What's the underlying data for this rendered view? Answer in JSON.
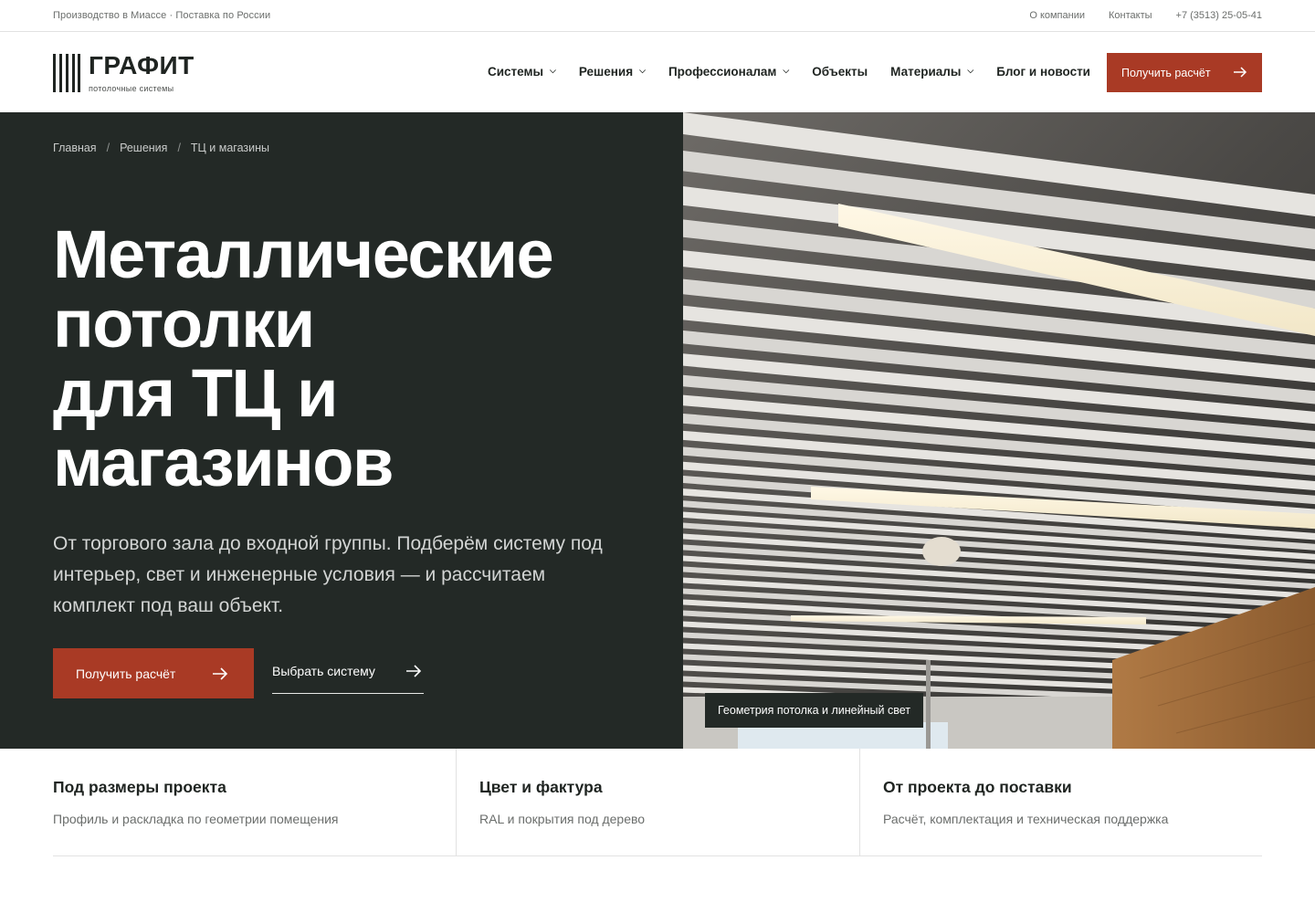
{
  "topbar": {
    "tagline": "Производство в Миассе · Поставка по России",
    "links": [
      "О компании",
      "Контакты",
      "+7 (3513) 25-05-41"
    ]
  },
  "brand": {
    "name": "ГРАФИТ",
    "subtitle": "потолочные системы"
  },
  "nav": {
    "items": [
      {
        "label": "Системы",
        "has_dropdown": true
      },
      {
        "label": "Решения",
        "has_dropdown": true
      },
      {
        "label": "Профессионалам",
        "has_dropdown": true
      },
      {
        "label": "Объекты",
        "has_dropdown": false
      },
      {
        "label": "Материалы",
        "has_dropdown": true
      },
      {
        "label": "Блог и новости",
        "has_dropdown": false
      }
    ],
    "cta_label": "Получить расчёт"
  },
  "breadcrumb": {
    "items": [
      "Главная",
      "Решения",
      "ТЦ и магазины"
    ],
    "separator": "/"
  },
  "hero": {
    "title_lines": [
      "Металлические",
      "потолки",
      "для ТЦ и",
      "магазинов"
    ],
    "text": "От торгового зала до входной группы. Подберём систему под интерьер, свет и инженерные условия — и рассчитаем комплект под ваш объект.",
    "primary_button": "Получить расчёт",
    "secondary_button": "Выбрать систему",
    "photo_caption": "Геометрия потолка и линейный свет"
  },
  "features": [
    {
      "title": "Под размеры проекта",
      "text": "Профиль и раскладка по геометрии помещения"
    },
    {
      "title": "Цвет и фактура",
      "text": "RAL и покрытия под дерево"
    },
    {
      "title": "От проекта до поставки",
      "text": "Расчёт, комплектация и техническая поддержка"
    }
  ],
  "colors": {
    "accent": "#a93a25",
    "dark_panel": "#232926",
    "text_dark": "#1f2421",
    "text_muted": "#6b6e6c"
  },
  "icons": {
    "arrow": "arrow-right-icon",
    "dropdown": "chevron-down-icon"
  }
}
